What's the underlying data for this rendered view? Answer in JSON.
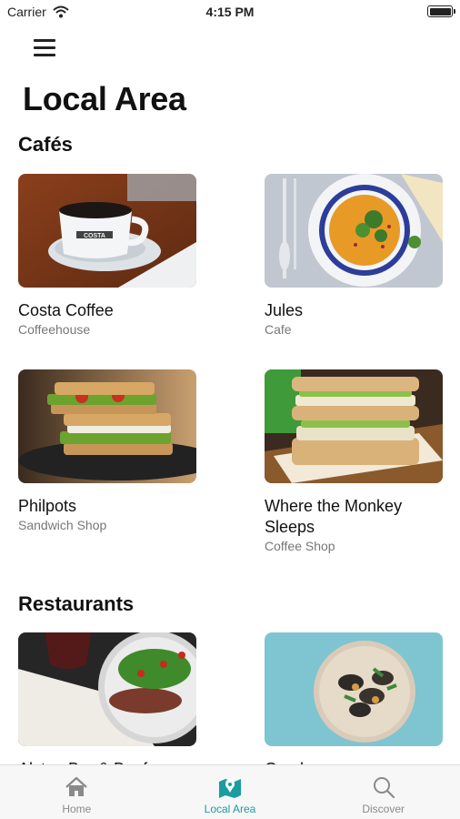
{
  "status_bar": {
    "carrier": "Carrier",
    "time": "4:15 PM"
  },
  "page": {
    "title": "Local Area"
  },
  "sections": [
    {
      "title": "Cafés",
      "items": [
        {
          "name": "Costa Coffee",
          "type": "Coffeehouse",
          "image": "coffee-cup-photo"
        },
        {
          "name": "Jules",
          "type": "Cafe",
          "image": "soup-bowl-photo"
        },
        {
          "name": "Philpots",
          "type": "Sandwich Shop",
          "image": "sandwich-photo"
        },
        {
          "name": "Where the Monkey Sleeps",
          "type": "Coffee Shop",
          "image": "sandwich-wrap-photo"
        }
      ]
    },
    {
      "title": "Restaurants",
      "items": [
        {
          "name": "Alston Bar & Beef",
          "type": "",
          "image": "steak-salad-photo"
        },
        {
          "name": "Gamba",
          "type": "",
          "image": "clams-plate-photo"
        }
      ]
    }
  ],
  "tab_bar": {
    "tabs": [
      {
        "label": "Home",
        "icon": "home-icon",
        "active": false
      },
      {
        "label": "Local Area",
        "icon": "map-icon",
        "active": true
      },
      {
        "label": "Discover",
        "icon": "search-icon",
        "active": false
      }
    ]
  },
  "colors": {
    "accent": "#1a9ca0",
    "inactive": "#8a8a8a",
    "tab_bar_bg": "#f7f7f7"
  }
}
